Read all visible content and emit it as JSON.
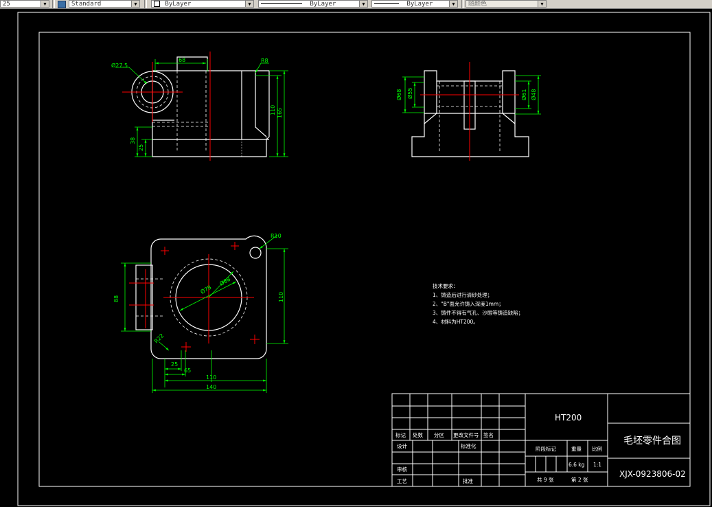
{
  "toolbar": {
    "dimscale": "25",
    "textstyle": "Standard",
    "layer": "ByLayer",
    "linetype": "ByLayer",
    "lineweight": "ByLayer",
    "color": "随颜色"
  },
  "dims": {
    "front_dia": "Ø27.5",
    "front_top": "68",
    "front_r": "R8",
    "front_h1": "110",
    "front_h2": "165",
    "front_base1": "38",
    "front_base2": "25",
    "side_l1": "Ø68",
    "side_l2": "Ø55",
    "side_r1": "Ø61",
    "side_r2": "Ø48",
    "plan_r": "R10",
    "plan_d1": "Ø78",
    "plan_d2": "Ø88",
    "plan_left": "88",
    "plan_right": "110",
    "plan_corner": "R22",
    "plan_b1": "25",
    "plan_b2": "65",
    "plan_b3": "110",
    "plan_b4": "140"
  },
  "notes": {
    "title": "技术要求：",
    "line1": "1、铸造后进行清砂处理；",
    "line2": "2、\"B\"面允许铸入深度1mm；",
    "line3": "3、铸件不得有气孔、沙眼等铸造缺陷；",
    "line4": "4、材料为HT200。"
  },
  "titleblock": {
    "material": "HT200",
    "drawing_name": "毛坯零件合图",
    "drawing_no": "XJX-0923806-02",
    "h_mark": "标记",
    "h_count": "处数",
    "h_zone": "分区",
    "h_docno": "更改文件号",
    "h_sign": "签名",
    "design": "设计",
    "standardize": "标准化",
    "review": "审核",
    "process": "工艺",
    "approve": "批准",
    "stage": "阶段标记",
    "weight": "重量",
    "scale": "比例",
    "weight_val": "6.6  kg",
    "scale_val": "1:1",
    "sheets": "共 9 张",
    "sheet": "第 2 张"
  }
}
